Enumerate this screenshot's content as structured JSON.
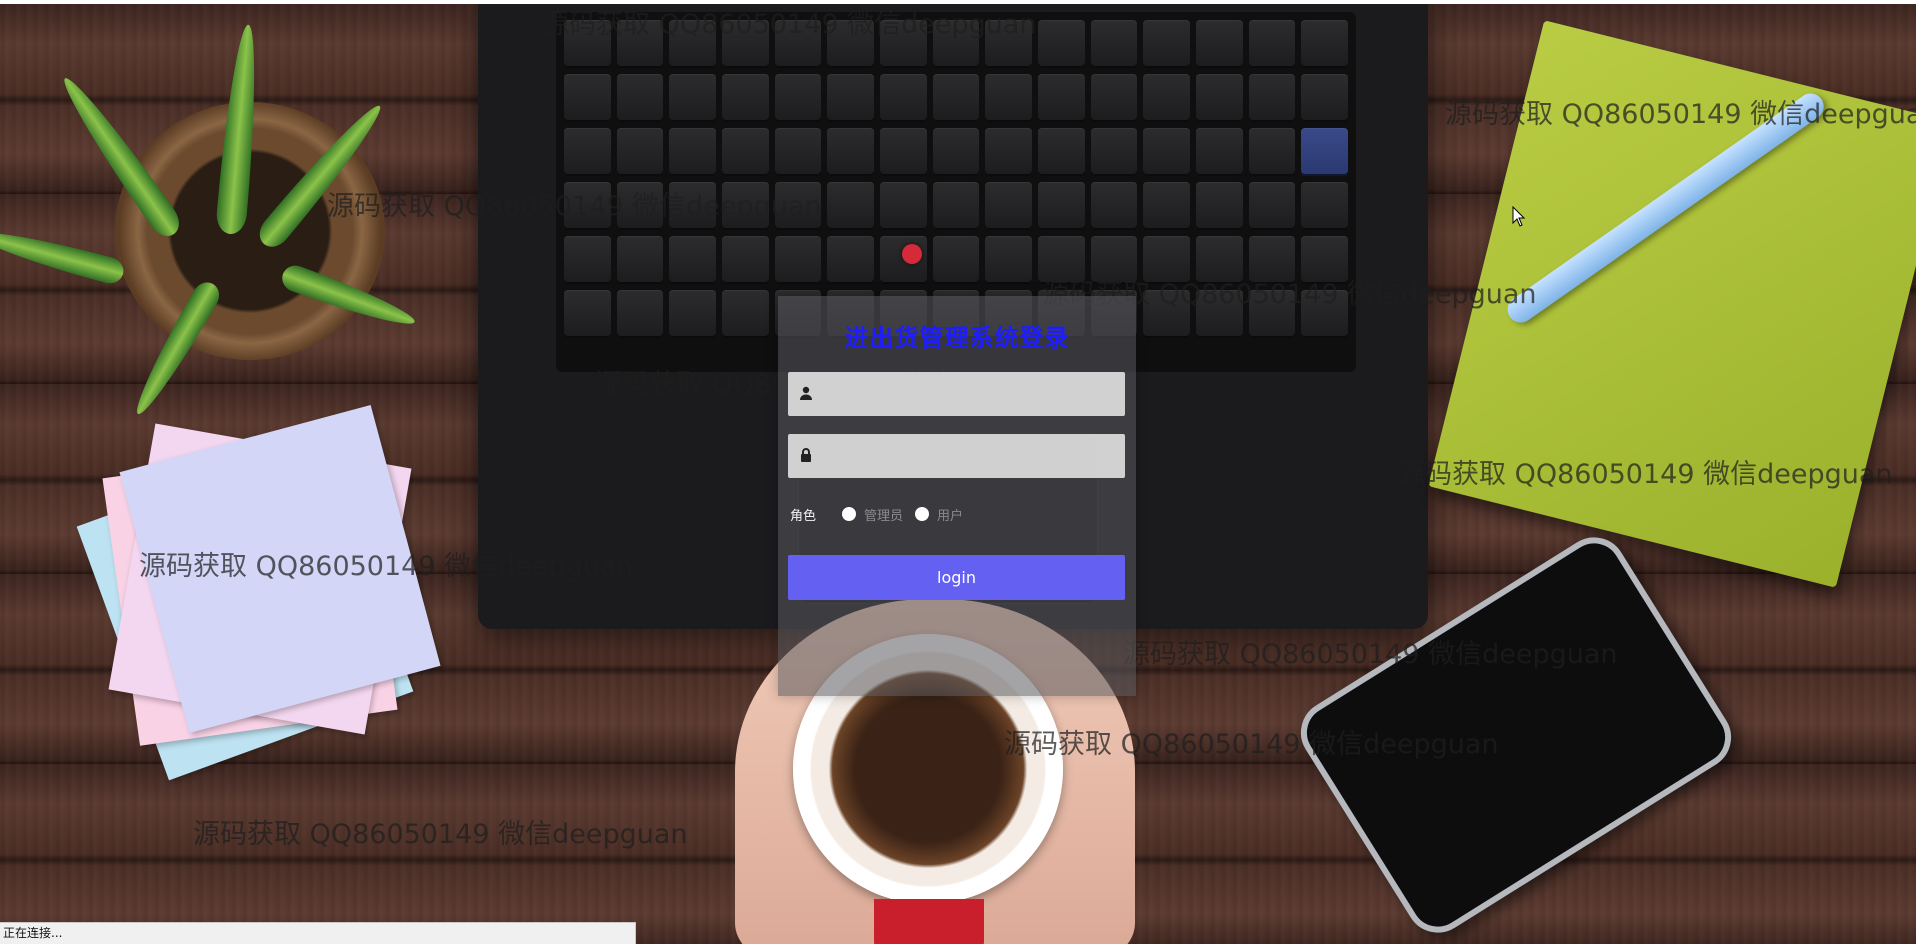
{
  "login": {
    "title": "进出货管理系统登录",
    "username_value": "",
    "password_value": "",
    "role_label": "角色",
    "roles": [
      "管理员",
      "用户"
    ],
    "submit_label": "login",
    "accent": "#6461f2",
    "title_color": "#1d1dff"
  },
  "watermark": {
    "text": "源码获取 QQ86050149 微信deepguan"
  },
  "status_bar": {
    "text": "正在连接..."
  },
  "icons": {
    "username": "user-icon",
    "password": "lock-icon"
  }
}
